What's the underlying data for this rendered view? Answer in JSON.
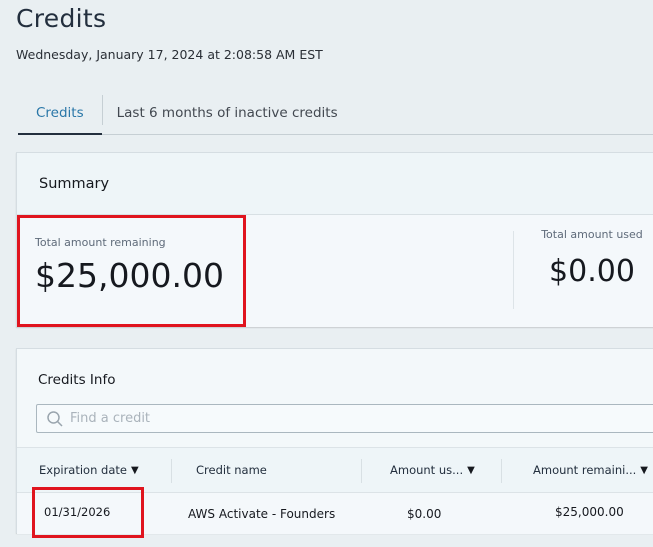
{
  "page": {
    "title": "Credits",
    "timestamp": "Wednesday, January 17, 2024 at 2:08:58 AM EST"
  },
  "tabs": [
    {
      "label": "Credits",
      "active": true
    },
    {
      "label": "Last 6 months of inactive credits",
      "active": false
    }
  ],
  "summary": {
    "title": "Summary",
    "total_remaining_label": "Total amount remaining",
    "total_remaining_value": "$25,000.00",
    "total_used_label": "Total amount used",
    "total_used_value": "$0.00"
  },
  "credits_info": {
    "title": "Credits Info",
    "search_placeholder": "Find a credit",
    "columns": [
      {
        "label": "Expiration date",
        "sort_icon": "▼"
      },
      {
        "label": "Credit name"
      },
      {
        "label": "Amount us...",
        "sort_icon": "▼"
      },
      {
        "label": "Amount remaini...",
        "sort_icon": "▼"
      }
    ],
    "rows": [
      {
        "expiration_date": "01/31/2026",
        "credit_name": "AWS Activate - Founders",
        "amount_used": "$0.00",
        "amount_remaining": "$25,000.00"
      }
    ]
  },
  "colors": {
    "accent_tab": "#2a77a8",
    "highlight_border": "#e0141e"
  }
}
